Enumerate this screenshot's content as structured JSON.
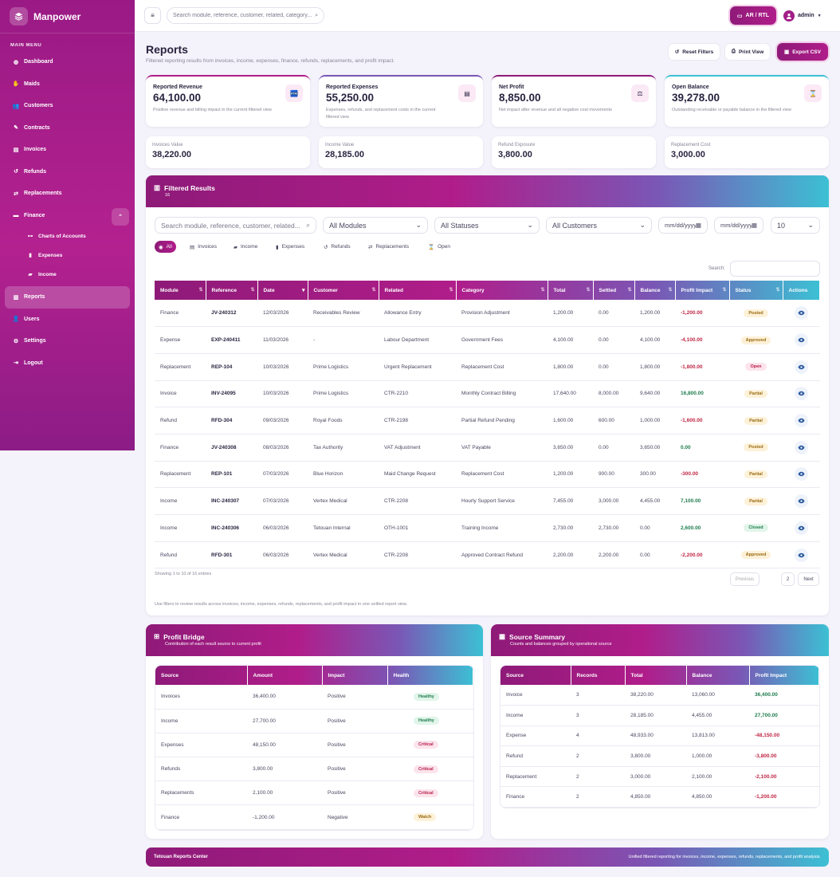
{
  "brand": {
    "name": "Manpower"
  },
  "sidebar": {
    "menu_title": "MAIN MENU",
    "items": [
      {
        "label": "Dashboard",
        "icon": "dashboard-icon"
      },
      {
        "label": "Maids",
        "icon": "maid-icon"
      },
      {
        "label": "Customers",
        "icon": "users-icon"
      },
      {
        "label": "Contracts",
        "icon": "contract-icon"
      },
      {
        "label": "Invoices",
        "icon": "invoice-icon"
      },
      {
        "label": "Refunds",
        "icon": "refund-icon"
      },
      {
        "label": "Replacements",
        "icon": "replace-icon"
      },
      {
        "label": "Finance",
        "icon": "finance-icon"
      }
    ],
    "finance_sub": [
      {
        "label": "Charts of Accounts"
      },
      {
        "label": "Expenses"
      },
      {
        "label": "Income"
      }
    ],
    "bottom_items": [
      {
        "label": "Reports"
      },
      {
        "label": "Users"
      },
      {
        "label": "Settings"
      },
      {
        "label": "Logout"
      }
    ]
  },
  "topbar": {
    "search_placeholder": "Search module, reference, customer, related, category...",
    "lang_label": "AR / RTL",
    "user_label": "admin"
  },
  "header": {
    "title": "Reports",
    "subtitle": "Filtered reporting results from invoices, income, expenses, finance, refunds, replacements, and profit impact.",
    "reset_label": "Reset Filters",
    "print_label": "Print View",
    "export_label": "Export CSV"
  },
  "stats": [
    {
      "label": "Reported Revenue",
      "value": "64,100.00",
      "desc": "Positive revenue and billing impact in the current filtered view"
    },
    {
      "label": "Reported Expenses",
      "value": "55,250.00",
      "desc": "Expenses, refunds, and replacement costs in the current filtered view"
    },
    {
      "label": "Net Profit",
      "value": "8,850.00",
      "desc": "Net impact after revenue and all negative cost movements"
    },
    {
      "label": "Open Balance",
      "value": "39,278.00",
      "desc": "Outstanding receivable or payable balance in the filtered view"
    }
  ],
  "minis": [
    {
      "label": "Invoices Value",
      "value": "38,220.00"
    },
    {
      "label": "Income Value",
      "value": "28,185.00"
    },
    {
      "label": "Refund Exposure",
      "value": "3,800.00"
    },
    {
      "label": "Replacement Cost",
      "value": "3,000.00"
    }
  ],
  "results": {
    "title": "Filtered Results",
    "count": "16",
    "filters": {
      "search_placeholder": "Search module, reference, customer, related...",
      "module": "All Modules",
      "status": "All Statuses",
      "customer": "All Customers",
      "date_from": "mm/dd/yyyy",
      "date_to": "mm/dd/yyyy",
      "page_size": "10"
    },
    "chips": [
      "All",
      "Invoices",
      "Income",
      "Expenses",
      "Refunds",
      "Replacements",
      "Open"
    ],
    "search_label": "Search:",
    "columns": [
      "Module",
      "Reference",
      "Date",
      "Customer",
      "Related",
      "Category",
      "Total",
      "Settled",
      "Balance",
      "Profit Impact",
      "Status",
      "Actions"
    ],
    "rows": [
      {
        "module": "Finance",
        "ref": "JV-240312",
        "date": "12/03/2026",
        "customer": "Receivables Review",
        "related": "Allowance Entry",
        "category": "Provision Adjustment",
        "total": "1,200.00",
        "settled": "0.00",
        "balance": "1,200.00",
        "impact": "-1,200.00",
        "sign": "neg",
        "status": "Posted"
      },
      {
        "module": "Expense",
        "ref": "EXP-240411",
        "date": "11/03/2026",
        "customer": "-",
        "related": "Labour Department",
        "category": "Government Fees",
        "total": "4,100.00",
        "settled": "0.00",
        "balance": "4,100.00",
        "impact": "-4,100.00",
        "sign": "neg",
        "status": "Approved"
      },
      {
        "module": "Replacement",
        "ref": "REP-104",
        "date": "10/03/2026",
        "customer": "Prime Logistics",
        "related": "Urgent Replacement",
        "category": "Replacement Cost",
        "total": "1,800.00",
        "settled": "0.00",
        "balance": "1,800.00",
        "impact": "-1,800.00",
        "sign": "neg",
        "status": "Open"
      },
      {
        "module": "Invoice",
        "ref": "INV-24095",
        "date": "10/03/2026",
        "customer": "Prime Logistics",
        "related": "CTR-2210",
        "category": "Monthly Contract Billing",
        "total": "17,640.00",
        "settled": "8,000.00",
        "balance": "9,640.00",
        "impact": "16,800.00",
        "sign": "pos",
        "status": "Partial"
      },
      {
        "module": "Refund",
        "ref": "RFD-304",
        "date": "09/03/2026",
        "customer": "Royal Foods",
        "related": "CTR-2198",
        "category": "Partial Refund Pending",
        "total": "1,600.00",
        "settled": "600.00",
        "balance": "1,000.00",
        "impact": "-1,600.00",
        "sign": "neg",
        "status": "Partial"
      },
      {
        "module": "Finance",
        "ref": "JV-240308",
        "date": "08/03/2026",
        "customer": "Tax Authority",
        "related": "VAT Adjustment",
        "category": "VAT Payable",
        "total": "3,650.00",
        "settled": "0.00",
        "balance": "3,650.00",
        "impact": "0.00",
        "sign": "pos",
        "status": "Posted"
      },
      {
        "module": "Replacement",
        "ref": "REP-101",
        "date": "07/03/2026",
        "customer": "Blue Horizon",
        "related": "Maid Change Request",
        "category": "Replacement Cost",
        "total": "1,200.00",
        "settled": "900.00",
        "balance": "300.00",
        "impact": "-300.00",
        "sign": "neg",
        "status": "Partial"
      },
      {
        "module": "Income",
        "ref": "INC-240307",
        "date": "07/03/2026",
        "customer": "Vertex Medical",
        "related": "CTR-2208",
        "category": "Hourly Support Service",
        "total": "7,455.00",
        "settled": "3,000.00",
        "balance": "4,455.00",
        "impact": "7,100.00",
        "sign": "pos",
        "status": "Partial"
      },
      {
        "module": "Income",
        "ref": "INC-240306",
        "date": "06/03/2026",
        "customer": "Tetouan Internal",
        "related": "OTH-1001",
        "category": "Training Income",
        "total": "2,730.00",
        "settled": "2,730.00",
        "balance": "0.00",
        "impact": "2,600.00",
        "sign": "pos",
        "status": "Closed"
      },
      {
        "module": "Refund",
        "ref": "RFD-301",
        "date": "06/03/2026",
        "customer": "Vertex Medical",
        "related": "CTR-2208",
        "category": "Approved Contract Refund",
        "total": "2,200.00",
        "settled": "2,200.00",
        "balance": "0.00",
        "impact": "-2,200.00",
        "sign": "neg",
        "status": "Approved"
      }
    ],
    "showing": "Showing 1 to 10 of 16 entries",
    "pagination": {
      "prev": "Previous",
      "pages": [
        "1",
        "2"
      ],
      "next": "Next"
    },
    "note": "Use filters to review results across invoices, income, expenses, refunds, replacements, and profit impact in one unified report view."
  },
  "profit_bridge": {
    "title": "Profit Bridge",
    "subtitle": "Contribution of each result source to current profit",
    "columns": [
      "Source",
      "Amount",
      "Impact",
      "Health"
    ],
    "rows": [
      {
        "source": "Invoices",
        "amount": "36,400.00",
        "impact": "Positive",
        "health": "Healthy"
      },
      {
        "source": "Income",
        "amount": "27,700.00",
        "impact": "Positive",
        "health": "Healthy"
      },
      {
        "source": "Expenses",
        "amount": "48,150.00",
        "impact": "Positive",
        "health": "Critical"
      },
      {
        "source": "Refunds",
        "amount": "3,800.00",
        "impact": "Positive",
        "health": "Critical"
      },
      {
        "source": "Replacements",
        "amount": "2,100.00",
        "impact": "Positive",
        "health": "Critical"
      },
      {
        "source": "Finance",
        "amount": "-1,200.00",
        "impact": "Negative",
        "health": "Watch"
      }
    ]
  },
  "source_summary": {
    "title": "Source Summary",
    "subtitle": "Counts and balances grouped by operational source",
    "columns": [
      "Source",
      "Records",
      "Total",
      "Balance",
      "Profit Impact"
    ],
    "rows": [
      {
        "source": "Invoice",
        "records": "3",
        "total": "38,220.00",
        "balance": "13,060.00",
        "impact": "36,400.00",
        "sign": "pos"
      },
      {
        "source": "Income",
        "records": "3",
        "total": "28,185.00",
        "balance": "4,455.00",
        "impact": "27,700.00",
        "sign": "pos"
      },
      {
        "source": "Expense",
        "records": "4",
        "total": "48,933.00",
        "balance": "13,813.00",
        "impact": "-48,150.00",
        "sign": "neg"
      },
      {
        "source": "Refund",
        "records": "2",
        "total": "3,800.00",
        "balance": "1,000.00",
        "impact": "-3,800.00",
        "sign": "neg"
      },
      {
        "source": "Replacement",
        "records": "2",
        "total": "3,000.00",
        "balance": "2,100.00",
        "impact": "-2,100.00",
        "sign": "neg"
      },
      {
        "source": "Finance",
        "records": "2",
        "total": "4,850.00",
        "balance": "4,850.00",
        "impact": "-1,200.00",
        "sign": "neg"
      }
    ]
  },
  "footer": {
    "left": "Tetouan Reports Center",
    "right": "Unified filtered reporting for invoices, income, expenses, refunds, replacements, and profit analysis."
  },
  "colors": {
    "accent": "#a31e87",
    "accent_dark": "#8e1a78",
    "teal": "#3cc0d4",
    "negative": "#c02745",
    "positive": "#1f7d4e"
  }
}
